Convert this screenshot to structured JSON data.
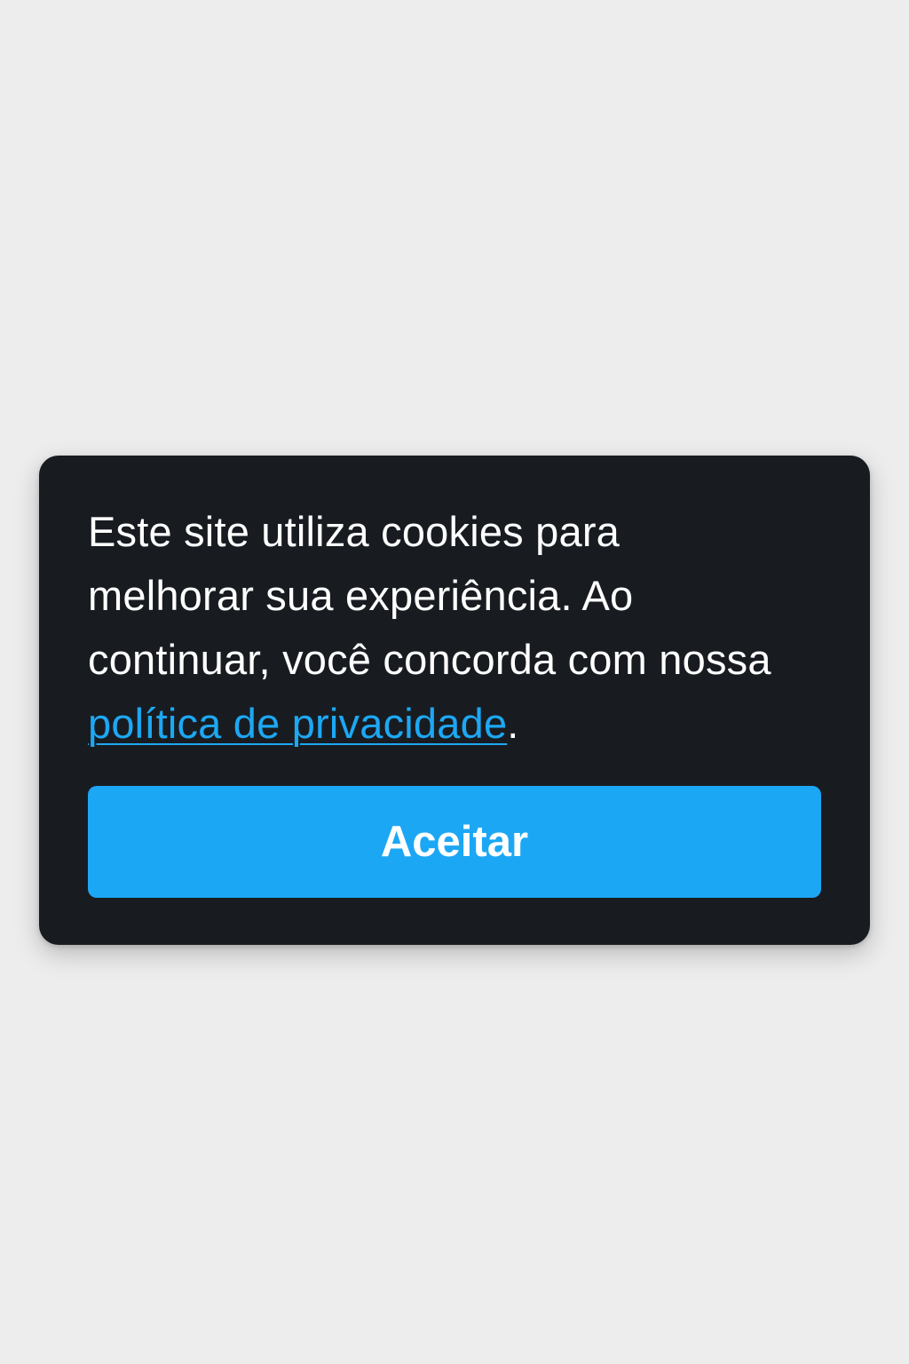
{
  "cookie_banner": {
    "message_prefix": "Este site utiliza cookies para melhorar sua experiência. Ao continuar, você concorda com nossa ",
    "policy_link_label": "política de privacidade",
    "message_suffix": ".",
    "accept_label": "Aceitar"
  },
  "colors": {
    "page_background": "#ededed",
    "card_background": "#181c21",
    "text": "#ffffff",
    "link": "#1da8f4",
    "button": "#1ca7f5"
  }
}
